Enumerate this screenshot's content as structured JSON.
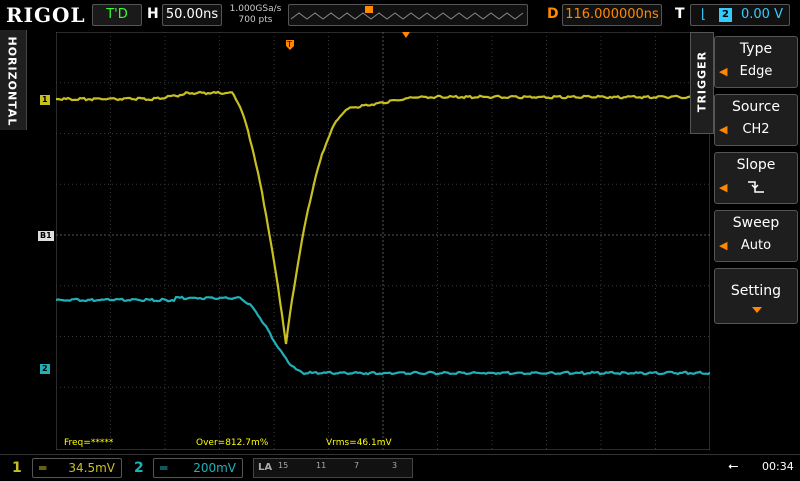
{
  "topbar": {
    "logo": "RIGOL",
    "status": "T'D",
    "h_label": "H",
    "timebase": "50.00ns",
    "sample_rate": "1.000GSa/s",
    "mem_depth": "700 pts",
    "trigger_pos_marker": "T",
    "d_label": "D",
    "delay": "116.000000ns",
    "t_label": "T",
    "trig_channel": "2",
    "trig_level": "0.00 V",
    "trig_slope_icon": "falling-edge-icon"
  },
  "left_tab": {
    "label": "HORIZONTAL"
  },
  "right_panel": {
    "tab_label": "TRIGGER",
    "items": [
      {
        "title": "Type",
        "value": "Edge"
      },
      {
        "title": "Source",
        "value": "CH2"
      },
      {
        "title": "Slope",
        "value": "",
        "icon": "falling-edge-icon"
      },
      {
        "title": "Sweep",
        "value": "Auto"
      },
      {
        "title": "Setting",
        "value": ""
      }
    ]
  },
  "plot": {
    "ch1_marker": "1",
    "ch2_marker": "2",
    "ref_marker": "B1",
    "colors": {
      "ch1": "#c8c020",
      "ch2": "#20b0b8",
      "grid": "#444444",
      "trigger": "#ff8800"
    }
  },
  "readout": {
    "freq": "Freq=*****",
    "over": "Over=812.7m%",
    "vrms": "Vrms=46.1mV"
  },
  "bottombar": {
    "ch1_num": "1",
    "ch1_scale": "34.5mV",
    "ch2_num": "2",
    "ch2_scale": "200mV",
    "la_label": "LA",
    "la_nums": [
      "15",
      "11",
      "7",
      "3"
    ],
    "clock": "00:34"
  }
}
